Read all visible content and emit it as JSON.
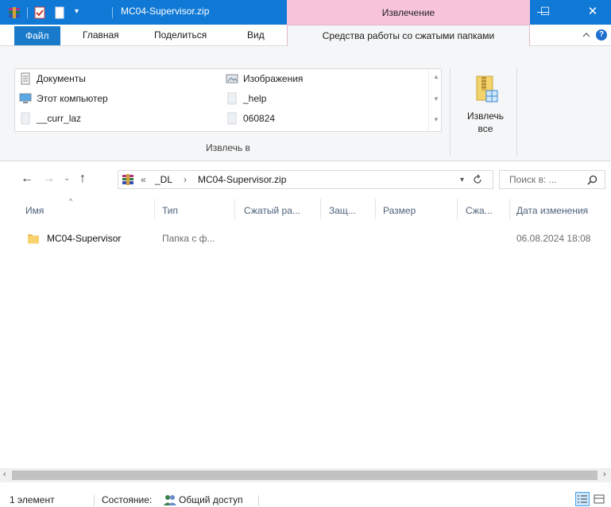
{
  "window": {
    "title": "MC04-Supervisor.zip",
    "context_tab_title": "Извлечение",
    "minimize_glyph": "—",
    "maximize_glyph": "☐",
    "close_glyph": "✕",
    "titlebar_color": "#1079d6",
    "context_color": "#f7c4dc"
  },
  "ribbon": {
    "tabs": {
      "file": "Файл",
      "home": "Главная",
      "share": "Поделиться",
      "view": "Вид",
      "compressed_tools": "Средства работы со сжатыми папками"
    },
    "help_glyph": "?",
    "collapse_glyph": "^",
    "extract_to": {
      "items": [
        "Документы",
        "Изображения",
        "Этот компьютер",
        "_help",
        "__curr_laz",
        "060824"
      ],
      "group_label": "Извлечь в"
    },
    "extract_all": {
      "line1": "Извлечь",
      "line2": "все"
    }
  },
  "address": {
    "overflow": "«",
    "crumbs": [
      "_DL",
      "MC04-Supervisor.zip"
    ],
    "separator": "›",
    "search_placeholder": "Поиск в: ..."
  },
  "columns": [
    "Имя",
    "Тип",
    "Сжатый ра...",
    "Защ...",
    "Размер",
    "Сжа...",
    "Дата изменения"
  ],
  "files": [
    {
      "name": "MC04-Supervisor",
      "type": "Папка с ф...",
      "modified": "06.08.2024 18:08",
      "icon": "folder-icon"
    }
  ],
  "status": {
    "count": "1 элемент",
    "state_label": "Состояние:",
    "state_value": "Общий доступ"
  },
  "accent_color": "#1979ca"
}
